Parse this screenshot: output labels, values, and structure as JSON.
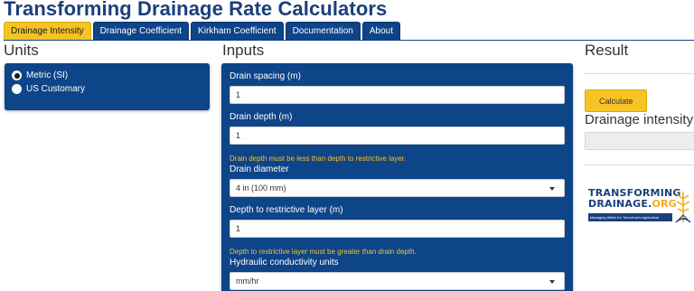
{
  "app": {
    "title": "Transforming Drainage Rate Calculators"
  },
  "tabs": [
    {
      "label": "Drainage Intensity",
      "active": true
    },
    {
      "label": "Drainage Coefficient",
      "active": false
    },
    {
      "label": "Kirkham Coefficient",
      "active": false
    },
    {
      "label": "Documentation",
      "active": false
    },
    {
      "label": "About",
      "active": false
    }
  ],
  "units": {
    "heading": "Units",
    "options": [
      {
        "label": "Metric (SI)",
        "checked": true
      },
      {
        "label": "US Customary",
        "checked": false
      }
    ]
  },
  "inputs": {
    "heading": "Inputs",
    "drain_spacing": {
      "label": "Drain spacing (m)",
      "value": "1"
    },
    "drain_depth": {
      "label": "Drain depth (m)",
      "value": "1",
      "warning": "Drain depth must be less than depth to restrictive layer."
    },
    "drain_diameter": {
      "label": "Drain diameter",
      "selected": "4 in (100 mm)"
    },
    "restrictive_depth": {
      "label": "Depth to restrictive layer (m)",
      "value": "1",
      "warning": "Depth to restrictive layer must be greater than drain depth."
    },
    "conductivity_units": {
      "label": "Hydraulic conductivity units",
      "selected": "mm/hr"
    }
  },
  "result": {
    "heading": "Result",
    "calculate_label": "Calculate",
    "output_label": "Drainage intensity",
    "output_value": ""
  },
  "logo": {
    "line1": "TRANSFORMING",
    "line2_main": "DRAINAGE.",
    "line2_org": "ORG",
    "tagline": "Managing Water for Tomorrow's Agriculture"
  },
  "colors": {
    "primary": "#0e4488",
    "accent": "#f5c324",
    "title": "#1b3f7a",
    "warning": "#f5c324"
  }
}
